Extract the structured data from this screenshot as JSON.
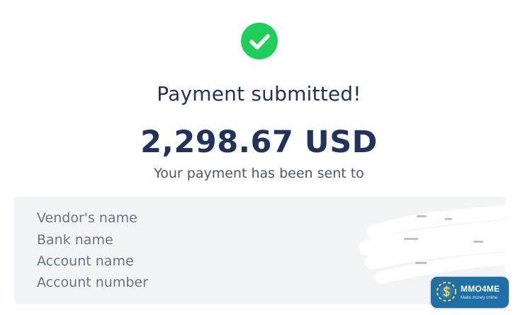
{
  "status": {
    "icon": "check-circle-icon",
    "accent_color": "#1ed05a",
    "title": "Payment submitted!"
  },
  "payment": {
    "amount": "2,298.67 USD",
    "subtitle": "Your payment has been sent to"
  },
  "details": {
    "vendor_name_label": "Vendor's name",
    "bank_name_label": "Bank name",
    "account_name_label": "Account name",
    "account_number_label": "Account number"
  },
  "watermark": {
    "brand": "MMO4ME",
    "tagline": "Make money online",
    "icon": "dollar-coin-icon"
  },
  "colors": {
    "heading": "#22325a",
    "panel_background": "#f3f4f6",
    "badge_background": "#1d6fa5"
  }
}
